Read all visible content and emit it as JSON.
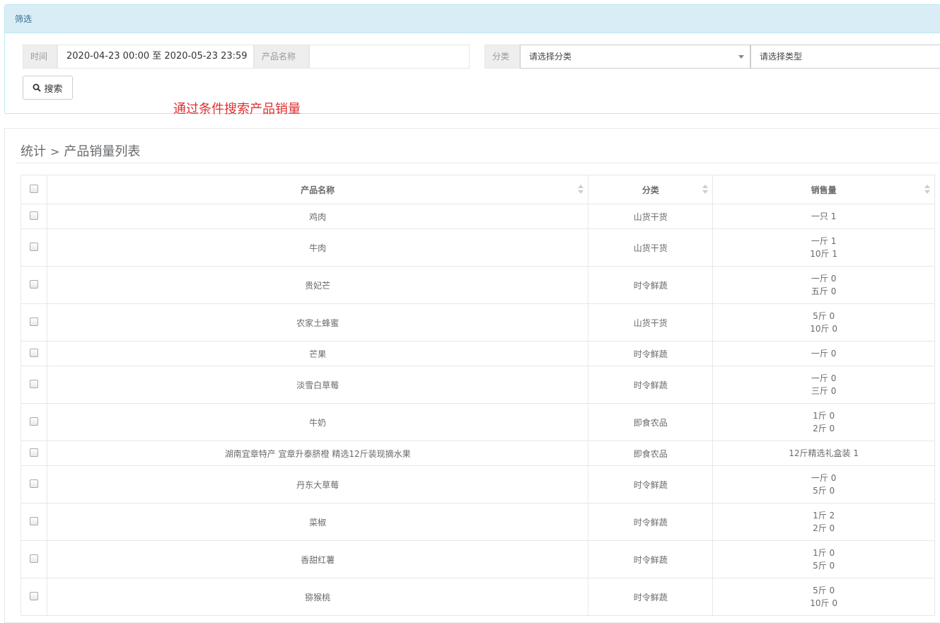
{
  "filter": {
    "heading": "筛选",
    "time_label": "时间",
    "time_value": "2020-04-23 00:00 至 2020-05-23 23:59",
    "product_label": "产品名称",
    "product_value": "",
    "category_label": "分类",
    "category_select": "请选择分类",
    "type_select": "请选择类型",
    "search_label": "搜索"
  },
  "annotation": "通过条件搜索产品销量",
  "breadcrumb": {
    "parent": "统计",
    "separator": ">",
    "current": "产品销量列表"
  },
  "table": {
    "headers": {
      "name": "产品名称",
      "category": "分类",
      "sales": "销售量"
    },
    "rows": [
      {
        "name": "鸡肉",
        "category": "山货干货",
        "sales": [
          "一只 1"
        ]
      },
      {
        "name": "牛肉",
        "category": "山货干货",
        "sales": [
          "一斤 1",
          "10斤 1"
        ]
      },
      {
        "name": "贵妃芒",
        "category": "时令鲜蔬",
        "sales": [
          "一斤 0",
          "五斤 0"
        ]
      },
      {
        "name": "农家土蜂蜜",
        "category": "山货干货",
        "sales": [
          "5斤 0",
          "10斤 0"
        ]
      },
      {
        "name": "芒果",
        "category": "时令鲜蔬",
        "sales": [
          "一斤 0"
        ]
      },
      {
        "name": "淡雪白草莓",
        "category": "时令鲜蔬",
        "sales": [
          "一斤 0",
          "三斤 0"
        ]
      },
      {
        "name": "牛奶",
        "category": "即食农品",
        "sales": [
          "1斤 0",
          "2斤 0"
        ]
      },
      {
        "name": "湖南宜章特产 宜章升泰脐橙 精选12斤装现摘水果",
        "category": "即食农品",
        "sales": [
          "12斤精选礼盒装 1"
        ]
      },
      {
        "name": "丹东大草莓",
        "category": "时令鲜蔬",
        "sales": [
          "一斤 0",
          "5斤 0"
        ]
      },
      {
        "name": "菜椒",
        "category": "时令鲜蔬",
        "sales": [
          "1斤 2",
          "2斤 0"
        ]
      },
      {
        "name": "香甜红薯",
        "category": "时令鲜蔬",
        "sales": [
          "1斤 0",
          "5斤 0"
        ]
      },
      {
        "name": "猕猴桃",
        "category": "时令鲜蔬",
        "sales": [
          "5斤 0",
          "10斤 0"
        ]
      }
    ]
  }
}
